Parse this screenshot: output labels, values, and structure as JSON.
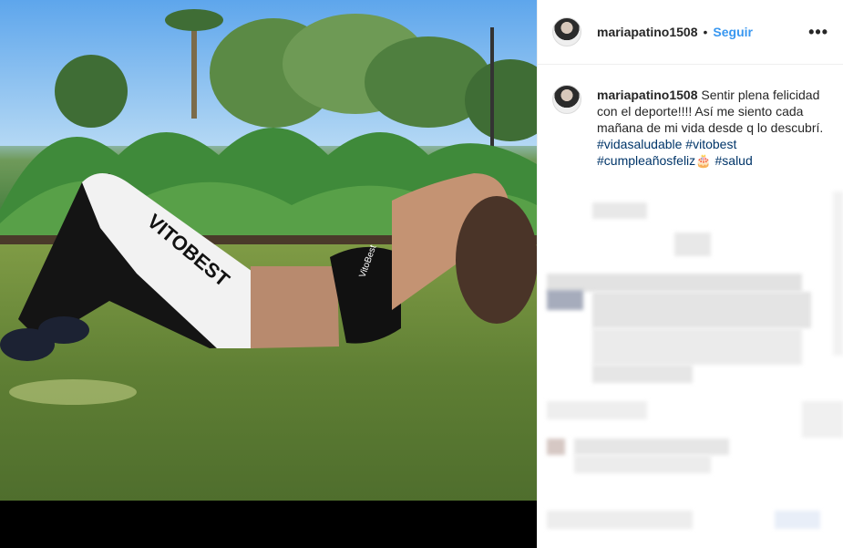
{
  "post": {
    "username": "mariapatino1508",
    "separator": "•",
    "follow_label": "Seguir",
    "more_label": "•••"
  },
  "caption": {
    "username": "mariapatino1508",
    "text": " Sentir plena felicidad con el deporte!!!! Así me siento cada mañana de mi vida desde q lo descubrí. ",
    "hashtags": [
      "#vidasaludable",
      "#vitobest",
      "#cumpleañosfeliz🎂",
      "#salud"
    ]
  },
  "photo": {
    "legging_brand": "VITOBEST",
    "top_brand": "VitoBest"
  },
  "colors": {
    "link": "#3897f0",
    "hashtag": "#003569",
    "text": "#262626",
    "border": "#efefef"
  }
}
